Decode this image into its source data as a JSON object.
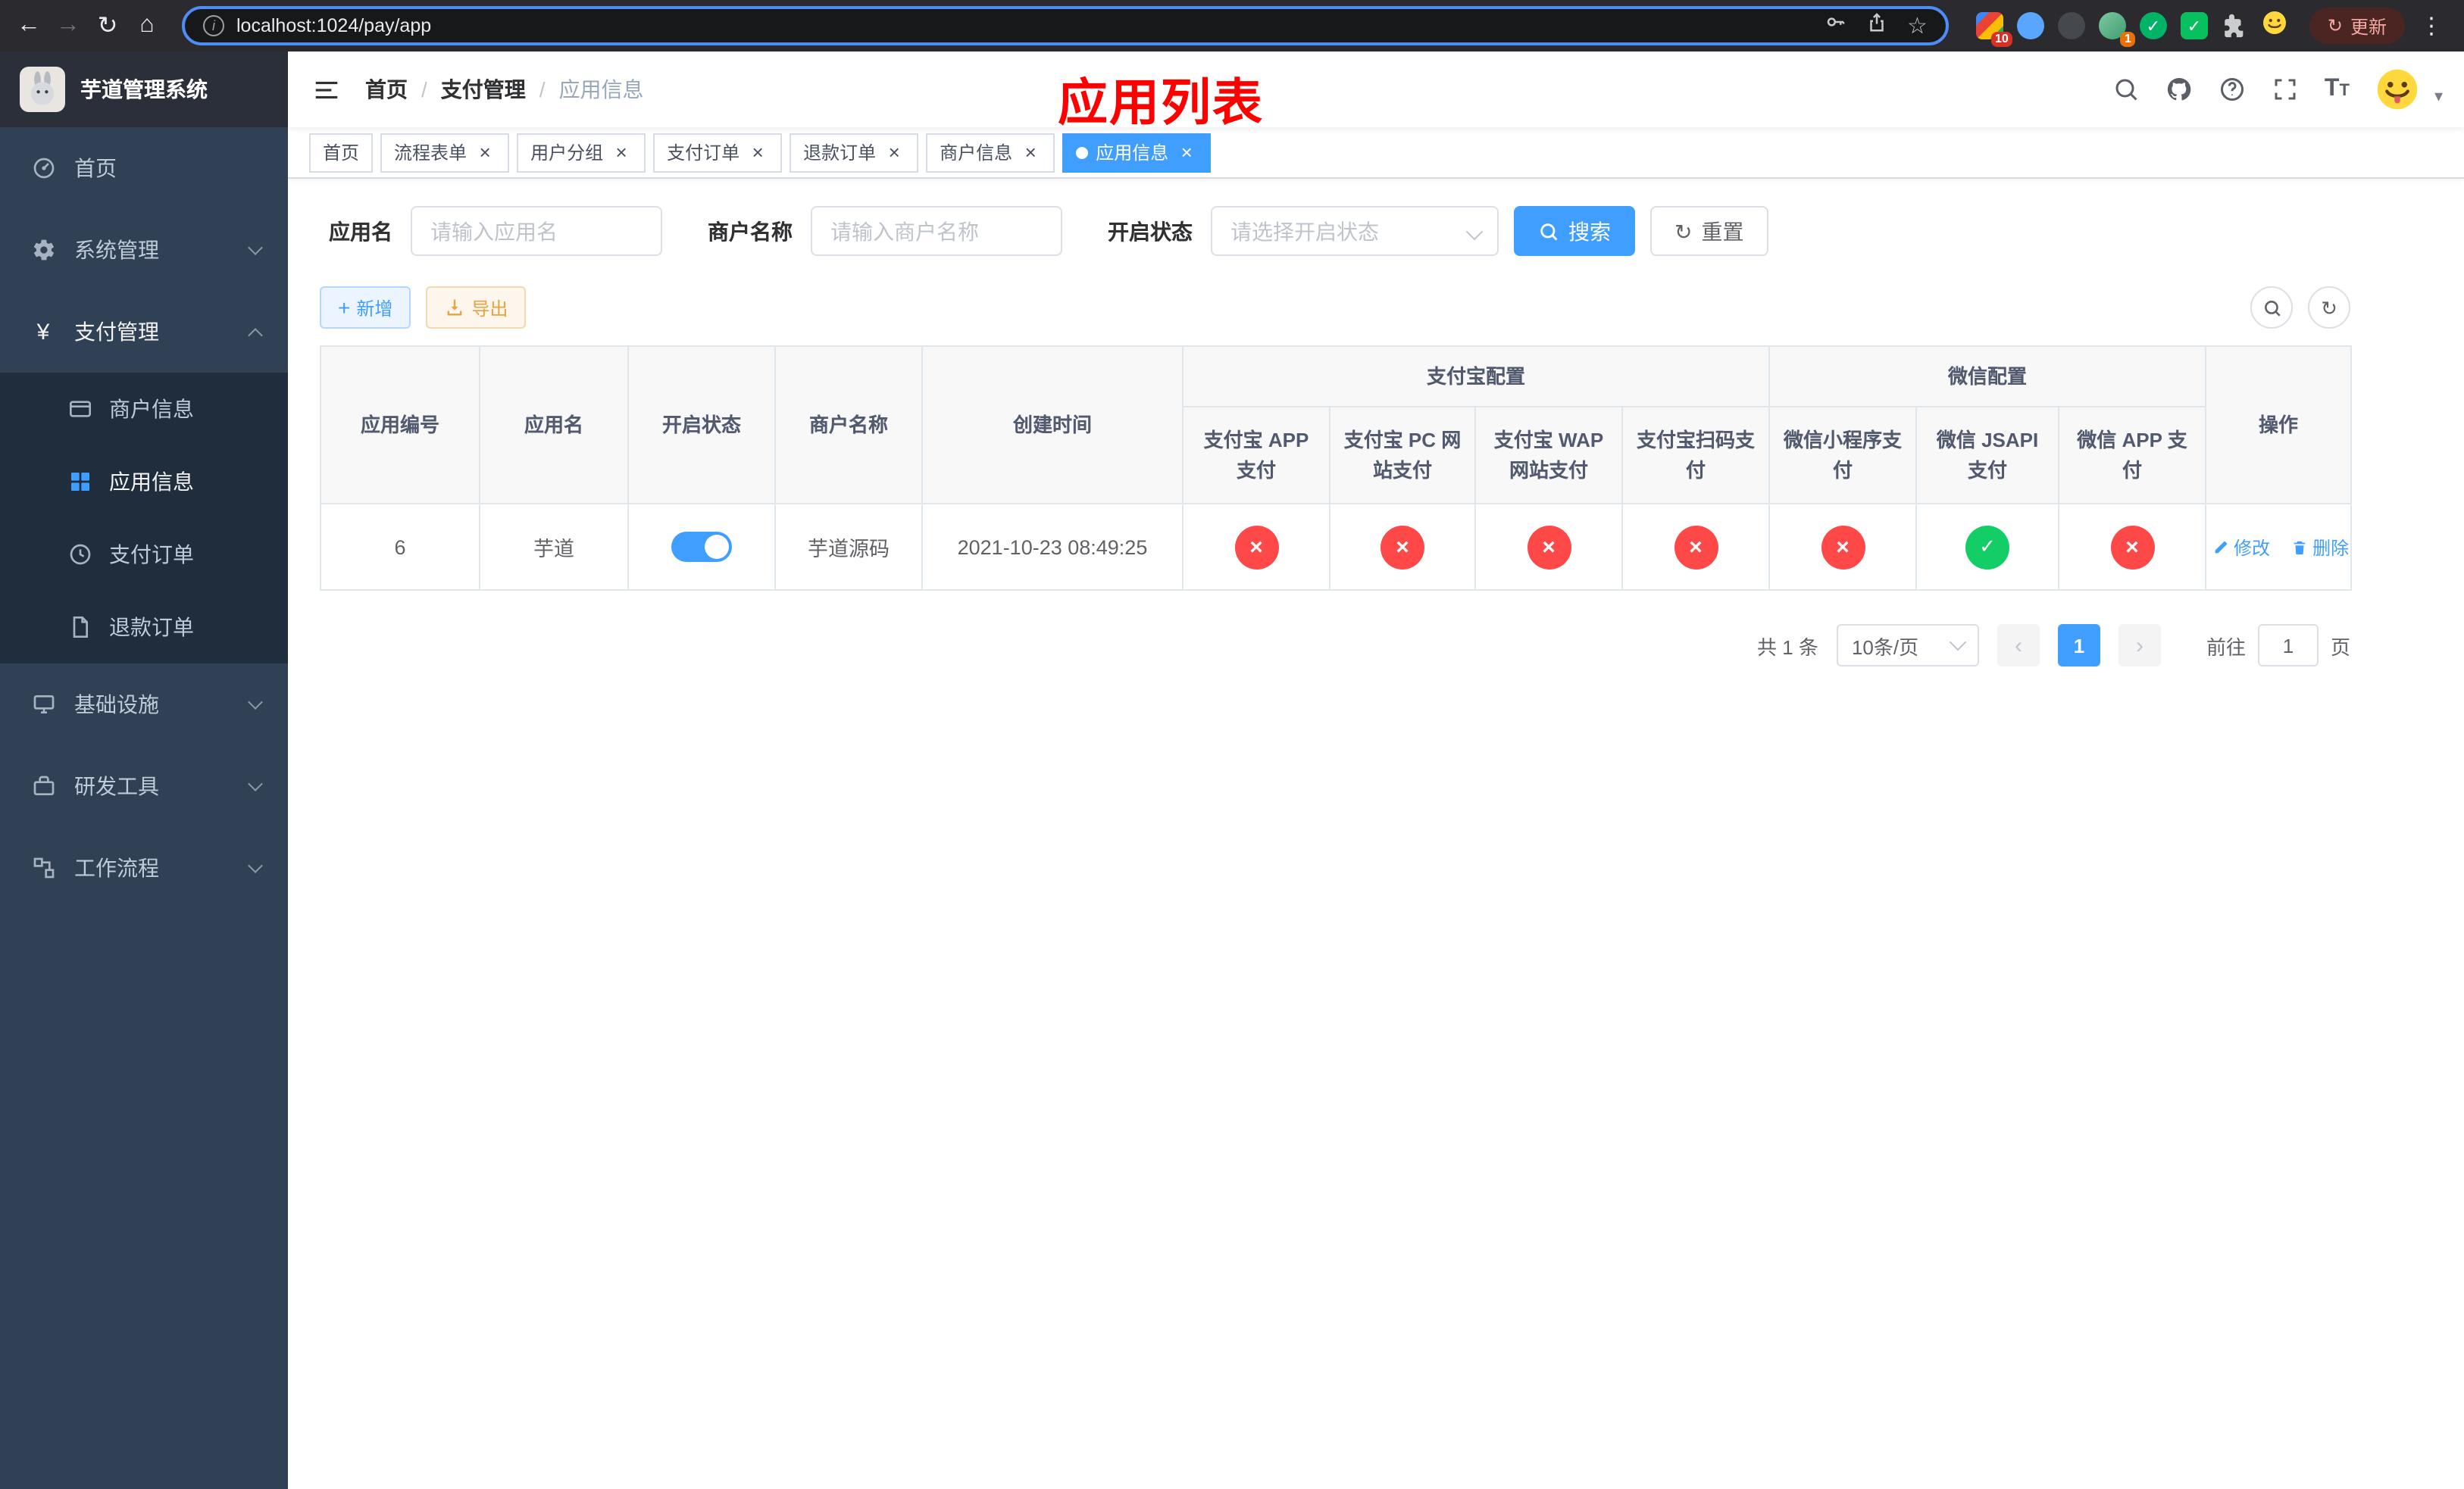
{
  "colors": {
    "primary": "#409eff",
    "success_circle": "#13ce66",
    "danger_circle": "#ff4949",
    "warning": "#e6a23c",
    "page_title_red": "#ff0000",
    "sidebar_bg": "#304156",
    "submenu_bg": "#1f2d3d"
  },
  "icons": {
    "back": "←",
    "forward": "→",
    "reload": "↻",
    "home": "⌂",
    "info": "i",
    "star": "☆",
    "menu_dots": "⋮",
    "close": "×",
    "yen": "¥",
    "plus": "+",
    "prev": "‹",
    "next": "›",
    "caret_down": "▾",
    "check": "✓"
  },
  "browser": {
    "url": "localhost:1024/pay/app",
    "update_button": "更新",
    "badges": {
      "ext1": "10",
      "ext4": "1"
    }
  },
  "sidebar": {
    "app_title": "芋道管理系统",
    "menu": [
      {
        "label": "首页"
      },
      {
        "label": "系统管理"
      },
      {
        "label": "支付管理",
        "state": "expanded"
      },
      {
        "label": "基础设施"
      },
      {
        "label": "研发工具"
      },
      {
        "label": "工作流程"
      }
    ],
    "submenu_pay": [
      {
        "label": "商户信息"
      },
      {
        "label": "应用信息",
        "state": "active"
      },
      {
        "label": "支付订单"
      },
      {
        "label": "退款订单"
      }
    ]
  },
  "navbar": {
    "breadcrumb": [
      {
        "label": "首页"
      },
      {
        "label": "支付管理"
      },
      {
        "label": "应用信息"
      }
    ],
    "breadcrumb_separator": "/",
    "page_title": "应用列表"
  },
  "tabs": [
    {
      "label": "首页"
    },
    {
      "label": "流程表单"
    },
    {
      "label": "用户分组"
    },
    {
      "label": "支付订单"
    },
    {
      "label": "退款订单"
    },
    {
      "label": "商户信息"
    },
    {
      "label": "应用信息",
      "state": "active"
    }
  ],
  "filters": {
    "app_name": {
      "label": "应用名",
      "placeholder": "请输入应用名"
    },
    "merchant_name": {
      "label": "商户名称",
      "placeholder": "请输入商户名称"
    },
    "status": {
      "label": "开启状态",
      "placeholder": "请选择开启状态"
    },
    "search_button": "搜索",
    "reset_button": "重置"
  },
  "toolbar": {
    "add_button": "新增",
    "export_button": "导出"
  },
  "table": {
    "headers": {
      "app_id": "应用编号",
      "app_name": "应用名",
      "status": "开启状态",
      "merchant": "商户名称",
      "created": "创建时间",
      "alipay_group": "支付宝配置",
      "wechat_group": "微信配置",
      "alipay_app": "支付宝 APP 支付",
      "alipay_pc": "支付宝 PC 网站支付",
      "alipay_wap": "支付宝 WAP 网站支付",
      "alipay_qr": "支付宝扫码支付",
      "wx_lite": "微信小程序支付",
      "wx_jsapi": "微信 JSAPI 支付",
      "wx_app": "微信 APP 支付",
      "actions": "操作"
    },
    "rows": [
      {
        "app_id": "6",
        "app_name": "芋道",
        "enabled": "on",
        "merchant": "芋道源码",
        "created": "2021-10-23 08:49:25",
        "configs": [
          "cross",
          "cross",
          "cross",
          "cross",
          "cross",
          "check",
          "cross"
        ],
        "edit_label": "修改",
        "delete_label": "删除"
      }
    ]
  },
  "pagination": {
    "total": "共 1 条",
    "page_size": "10条/页",
    "page": "1",
    "goto_label": "前往",
    "goto_value": "1",
    "goto_unit": "页"
  }
}
